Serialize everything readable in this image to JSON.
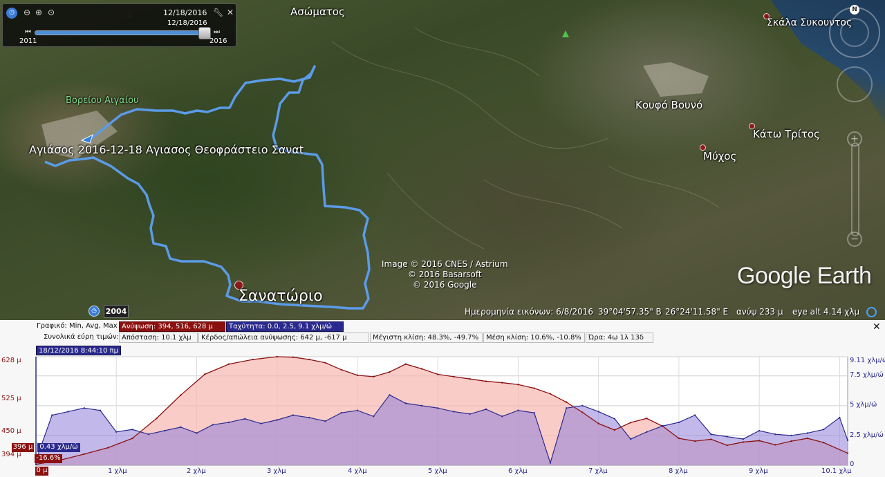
{
  "time_slider": {
    "current_date": "12/18/2016",
    "thumb_date": "12/18/2016",
    "start_year": "2011",
    "end_year": "2016",
    "position_fraction": 0.98
  },
  "map": {
    "places": {
      "asomatos": "Ασώματος",
      "skala_sykountos": "Σκάλα Συκουντος",
      "voreiou_aigaiou": "Βορείου Αιγαίου",
      "koufo_vouno": "Κουφό Βουνό",
      "kato_tritos": "Κάτω Τρίτος",
      "mychos": "Μύχος",
      "sanatorio": "Σανατώριο"
    },
    "track_label": "Αγιάσος  2016-12-18 Αγιασος Θεοφράστειο Σαναt",
    "credits": [
      "Image © 2016 CNES / Astrium",
      "© 2016 Basarsoft",
      "© 2016 Google"
    ],
    "logo": "Google Earth",
    "historical_year": "2004",
    "compass_letter": "N",
    "track_color": "#5b9be8"
  },
  "status_bar": {
    "imagery_date": "Ημερομηνία εικόνων: 6/8/2016",
    "latitude": "39°04'57.35\" B",
    "longitude": "26°24'11.58\" E",
    "elevation": "ανύψ   233 μ",
    "eye_alt": "eye alt   4.14 χλμ"
  },
  "profile": {
    "graph_label": "Γραφικό: Min, Avg, Max",
    "elevation_stat": "Ανύψωση: 394, 516, 628 μ",
    "speed_stat": "Ταχύτητα: 0.0, 2.5, 9.1 χλμ/ώ",
    "totals_label": "Συνολικά εύρη τιμών:",
    "distance_stat": "Απόσταση: 10.1 χλμ",
    "gain_stat": "Κέρδος/απώλεια ανύψωσης: 642 μ, -617 μ",
    "max_slope_stat": "Μέγιστη κλίση: 48.3%, -49.7%",
    "avg_slope_stat": "Μέση κλίση: 10.6%, -10.8%",
    "time_stat": "Ώρα: 4ω 1λ 13δ",
    "cursor_date": "18/12/2016 8:44:10 πμ",
    "close_glyph": "✕",
    "hover_elevation": "396 μ",
    "hover_speed": "0.43 χλμ/ώ",
    "hover_slope": "-16.6%",
    "hover_x": "0 μ"
  },
  "chart_data": {
    "type": "area",
    "x_unit": "χλμ",
    "x_ticks": [
      "0 μ",
      "1 χλμ",
      "2 χλμ",
      "3 χλμ",
      "4 χλμ",
      "5 χλμ",
      "6 χλμ",
      "7 χλμ",
      "8 χλμ",
      "9 χλμ",
      "10.1 χλμ"
    ],
    "xlim": [
      0,
      10.1
    ],
    "left_axis": {
      "ticks": [
        "628 μ",
        "525 μ",
        "450 μ",
        "394 μ"
      ],
      "ylim": [
        394,
        628
      ]
    },
    "right_axis": {
      "ticks": [
        "9.11 χλμ/ώ",
        "7.5 χλμ/ώ",
        "5 χλμ/ώ",
        "2.5 χλμ/ώ",
        "0"
      ],
      "ylim": [
        0,
        9.11
      ]
    },
    "series": [
      {
        "name": "Ανύψωση",
        "color": "#8b1010",
        "x": [
          0,
          0.3,
          0.6,
          0.9,
          1.2,
          1.5,
          1.8,
          2.1,
          2.4,
          2.7,
          3.0,
          3.2,
          3.4,
          3.6,
          3.8,
          4.0,
          4.2,
          4.4,
          4.6,
          4.8,
          5.0,
          5.2,
          5.4,
          5.6,
          5.8,
          6.0,
          6.2,
          6.4,
          6.6,
          6.8,
          7.0,
          7.2,
          7.4,
          7.6,
          7.8,
          8.0,
          8.2,
          8.4,
          8.6,
          8.8,
          9.0,
          9.2,
          9.4,
          9.6,
          9.8,
          10.1
        ],
        "values": [
          396,
          405,
          418,
          432,
          452,
          495,
          545,
          590,
          612,
          622,
          628,
          627,
          622,
          615,
          600,
          588,
          585,
          595,
          612,
          602,
          590,
          585,
          580,
          575,
          572,
          568,
          560,
          548,
          530,
          508,
          484,
          470,
          486,
          495,
          478,
          452,
          446,
          450,
          437,
          444,
          447,
          438,
          446,
          452,
          443,
          420
        ]
      },
      {
        "name": "Ταχύτητα",
        "color": "#2a2a8e",
        "x": [
          0,
          0.2,
          0.4,
          0.6,
          0.8,
          1.0,
          1.2,
          1.4,
          1.6,
          1.8,
          2.0,
          2.2,
          2.4,
          2.6,
          2.8,
          3.0,
          3.2,
          3.4,
          3.6,
          3.8,
          4.0,
          4.2,
          4.4,
          4.6,
          4.8,
          5.0,
          5.2,
          5.4,
          5.6,
          5.8,
          6.0,
          6.2,
          6.4,
          6.6,
          6.8,
          7.0,
          7.2,
          7.4,
          7.6,
          7.8,
          8.0,
          8.2,
          8.4,
          8.6,
          8.8,
          9.0,
          9.2,
          9.4,
          9.6,
          9.8,
          10.0,
          10.1
        ],
        "values": [
          0.4,
          4.2,
          4.5,
          4.8,
          4.6,
          2.8,
          3.0,
          2.6,
          2.9,
          3.2,
          2.7,
          3.4,
          3.6,
          3.9,
          3.5,
          3.8,
          4.2,
          4.0,
          3.7,
          4.4,
          4.6,
          4.1,
          5.9,
          5.2,
          5.0,
          4.8,
          4.5,
          4.3,
          4.7,
          4.1,
          4.6,
          4.4,
          0.2,
          4.8,
          5.0,
          4.5,
          3.9,
          2.2,
          2.8,
          3.3,
          3.6,
          4.2,
          2.6,
          2.4,
          2.2,
          2.9,
          2.6,
          2.5,
          2.7,
          3.0,
          4.0,
          2.1
        ]
      }
    ]
  }
}
